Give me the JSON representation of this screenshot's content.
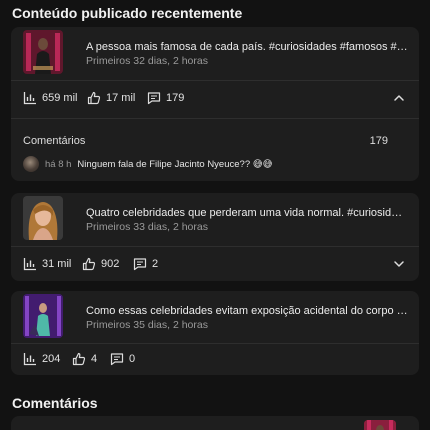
{
  "recent_section": {
    "title": "Conteúdo publicado recentemente"
  },
  "posts": [
    {
      "title": "A pessoa mais famosa de cada país. #curiosidades #famosos #hollywood",
      "meta": "Primeiros 32 dias, 2 horas",
      "views": "659 mil",
      "likes": "17 mil",
      "comments": "179",
      "expanded": true,
      "thumbnail": "thumbnail-pink-stage",
      "comments_panel": {
        "label": "Comentários",
        "count": "179",
        "latest": {
          "time": "há 8 h",
          "text": "Ninguem fala de Filipe Jacinto Nyeuce?? 😅😅"
        }
      }
    },
    {
      "title": "Quatro celebridades que perderam uma vida normal. #curiosidades #famosos",
      "meta": "Primeiros 33 dias, 2 horas",
      "views": "31 mil",
      "likes": "902",
      "comments": "2",
      "expanded": false,
      "thumbnail": "thumbnail-celebrity-portrait"
    },
    {
      "title": "Como essas celebridades evitam exposição acidental do corpo no palco",
      "meta": "Primeiros 35 dias, 2 horas",
      "views": "204",
      "likes": "4",
      "comments": "0",
      "expanded": false,
      "thumbnail": "thumbnail-purple-stage"
    }
  ],
  "comments_section": {
    "title": "Comentários"
  },
  "colors": {
    "background": "#121212",
    "card": "#1e1e1e",
    "text": "#e8e8e8",
    "muted": "#9a9a9a"
  }
}
